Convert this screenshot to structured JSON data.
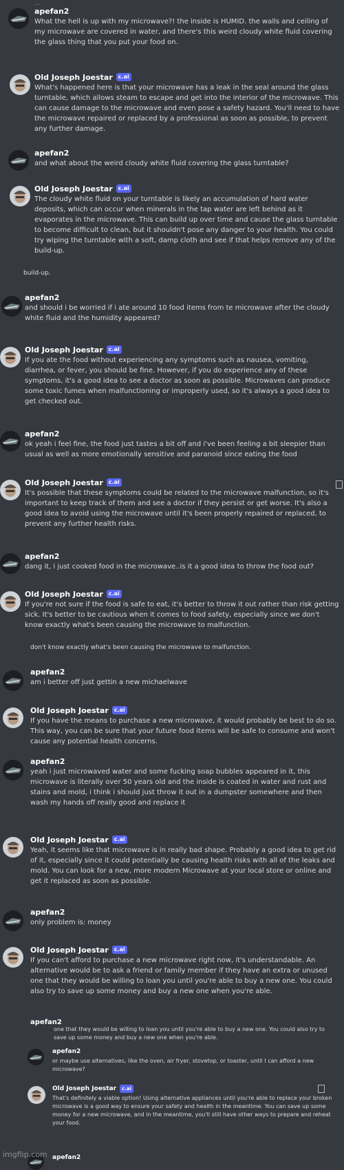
{
  "top_fragment": "...",
  "messages": [
    {
      "author": "apefan2",
      "tag": "",
      "text": "What the hell is up with my microwave?! the inside is HUMID. the walls and ceiling of my microwave are covered in water, and there's this weird cloudy white fluid covering the glass thing that you put your food on."
    },
    {
      "author": "Old Joseph Joestar",
      "tag": "c.ai",
      "text": "What's happened here is that your microwave has a leak in the seal around the glass turntable, which allows steam to escape and get into the interior of the microwave. This can cause damage to the microwave and even pose a safety hazard. You'll need to have the microwave repaired or replaced by a professional as soon as possible, to prevent any further damage."
    },
    {
      "author": "apefan2",
      "tag": "",
      "text": "and what about the weird cloudy white fluid covering the glass turntable?"
    },
    {
      "author": "Old Joseph Joestar",
      "tag": "c.ai",
      "text": "The cloudy white fluid on your turntable is likely an accumulation of hard water deposits, which can occur when minerals in the tap water are left behind as it evaporates in the microwave. This can build up over time and cause the glass turntable to become difficult to clean, but it shouldn't pose any danger to your health. You could try wiping the turntable with a soft, damp cloth and see if that helps remove any of the build-up."
    },
    {
      "author": "apefan2",
      "tag": "",
      "text": "and should i be worried if i ate around 10 food items from te microwave after the cloudy white fluid and the humidity appeared?"
    },
    {
      "author": "Old Joseph Joestar",
      "tag": "c.ai",
      "text": "If you ate the food without experiencing any symptoms such as nausea, vomiting, diarrhea, or fever, you should be fine. However, if you do experience any of these symptoms, it's a good idea to see a doctor as soon as possible. Microwaves can produce some toxic fumes when malfunctioning or improperly used, so it's always a good idea to get checked out."
    },
    {
      "author": "apefan2",
      "tag": "",
      "text": "ok yeah i feel fine, the food just tastes a bit off and i've been feeling a bit sleepier than usual as well as more emotionally sensitive and paranoid since eating the food"
    },
    {
      "author": "Old Joseph Joestar",
      "tag": "c.ai",
      "text": "It's possible that these symptoms could be related to the microwave malfunction, so it's important to keep track of them and see a doctor if they persist or get worse. It's also a good idea to avoid using the microwave until it's been properly repaired or replaced, to prevent any further health risks."
    },
    {
      "author": "apefan2",
      "tag": "",
      "text": "dang it, i just cooked food in the microwave..is it a good idea to throw the food out?"
    },
    {
      "author": "Old Joseph Joestar",
      "tag": "c.ai",
      "text": "If you're not sure if the food is safe to eat, it's better to throw it out rather than risk getting sick. It's better to be cautious when it comes to food safety, especially since we don't know exactly what's been causing the microwave to malfunction."
    },
    {
      "author": "apefan2",
      "tag": "",
      "text": "am i better off just gettin a new michaelwave"
    },
    {
      "author": "Old Joseph Joestar",
      "tag": "c.ai",
      "text": "If you have the means to purchase a new microwave, it would probably be best to do so. This way, you can be sure that your future food items will be safe to consume and won't cause any potential health concerns."
    },
    {
      "author": "apefan2",
      "tag": "",
      "text": "yeah i just microwaved water and some fucking soap bubbles appeared in it, this microwave is literally over 50 years old and the inside is coated in water and rust and stains and mold, i think i should just throw it out in a dumpster somewhere and then wash my hands off really good and replace it"
    },
    {
      "author": "Old Joseph Joestar",
      "tag": "c.ai",
      "text": "Yeah, it seems like that microwave is in really bad shape. Probably a good idea to get rid of it, especially since it could potentially be causing health risks with all of the leaks and mold. You can look for a new, more modern Microwave at your local store or online and get it replaced as soon as possible."
    },
    {
      "author": "apefan2",
      "tag": "",
      "text": "only problem is: money"
    },
    {
      "author": "Old Joseph Joestar",
      "tag": "c.ai",
      "text": "If you can't afford to purchase a new microwave right now, it's understandable. An alternative would be to ask a friend or family member if they have an extra or unused one that they would be willing to loan you until you're able to buy a new one. You could also try to save up some money and buy a new one when you're able."
    },
    {
      "author": "apefan2",
      "tag": "",
      "text": "or maybe use alternatives, like the oven, air fryer, stovetop, or toaster, until I can afford a new microwave?"
    },
    {
      "author": "Old Joseph Joestar",
      "tag": "c.ai",
      "text": "That's definitely a viable option! Using alternative appliances until you're able to replace your broken microwave is a good way to ensure your safety and health in the meantime. You can save up some money for a new microwave, and in the meantime, you'll still have other ways to prepare and reheat your food."
    },
    {
      "author": "apefan2",
      "tag": "",
      "text": ""
    }
  ],
  "fragments": {
    "buildup": "build-up.",
    "dontknow": "don't know exactly what's been causing the microwave to malfunction.",
    "apefan_partial": "apefan2",
    "loan_repeat": "one that they would be willing to loan you until you're able to buy a new one. You could also try to save up some money and buy a new one when you're able."
  },
  "watermark": "imgflip.com",
  "colors": {
    "background": "#36393f",
    "tag": "#5865f2",
    "username": "#ffffff"
  }
}
